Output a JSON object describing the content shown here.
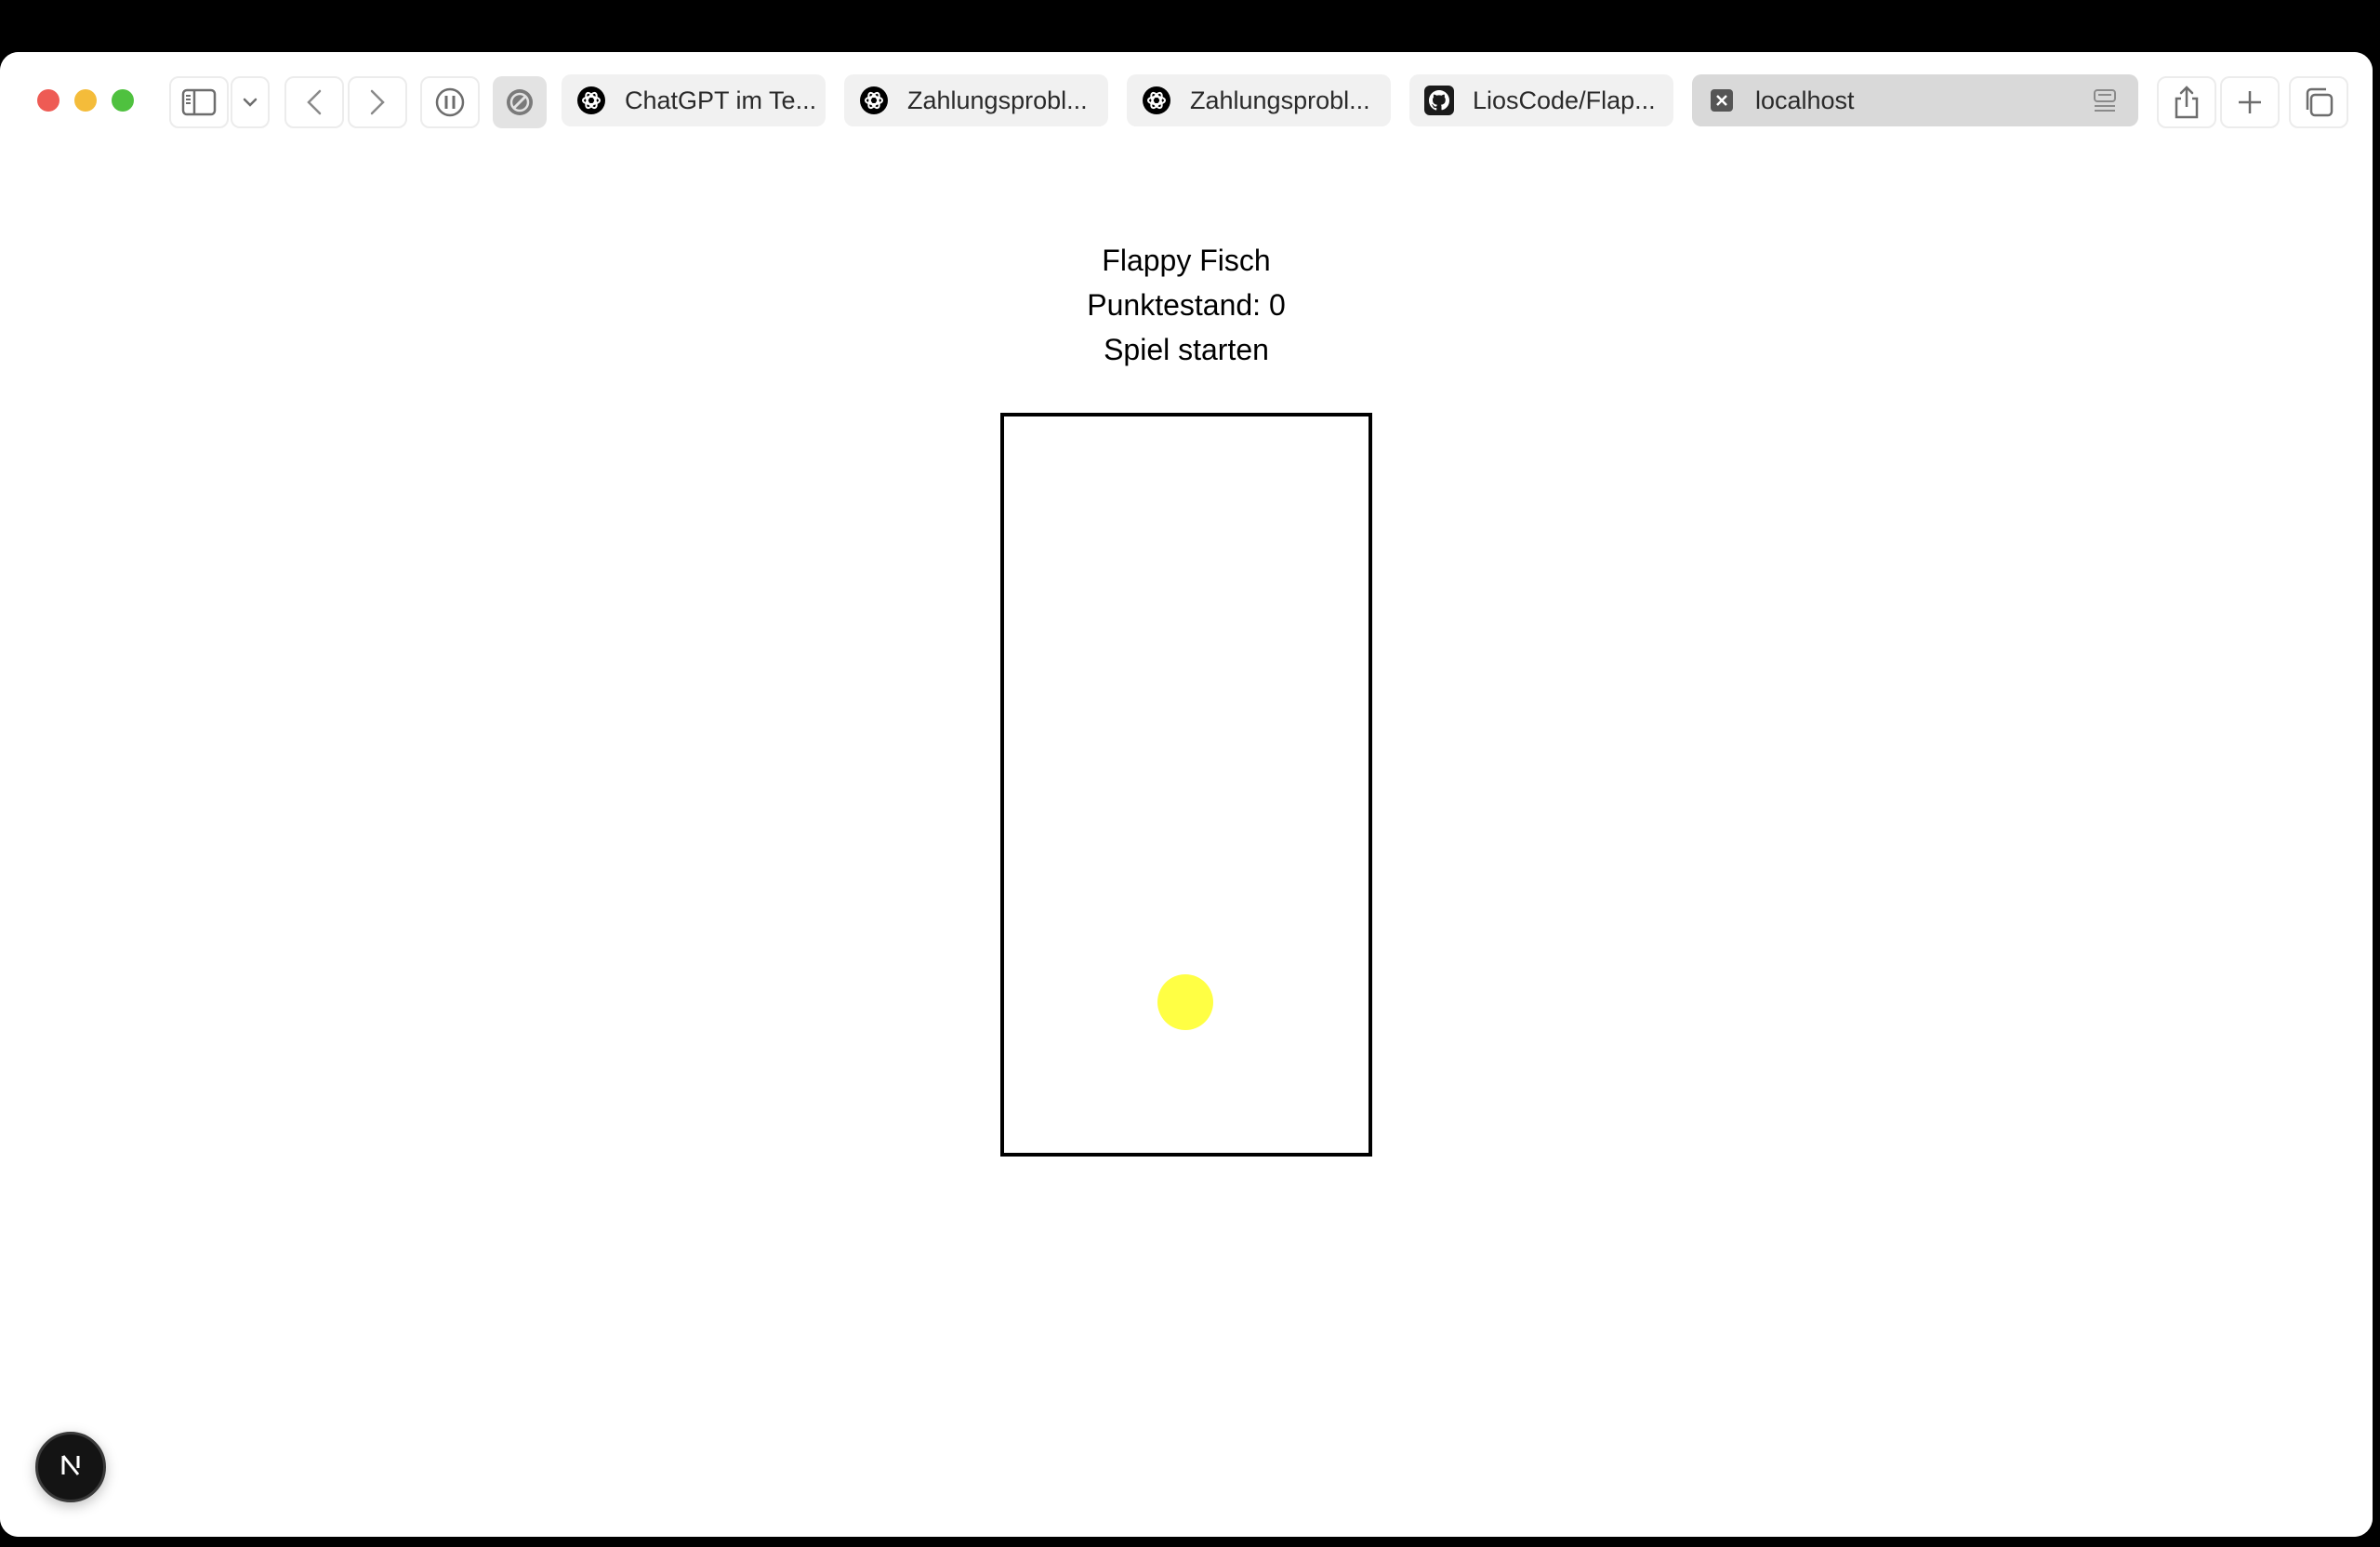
{
  "browser": {
    "tabs": [
      {
        "label": "ChatGPT im Te...",
        "icon": "openai-icon",
        "active": false
      },
      {
        "label": "Zahlungsprobl...",
        "icon": "openai-icon",
        "active": false
      },
      {
        "label": "Zahlungsprobl...",
        "icon": "openai-icon",
        "active": false
      },
      {
        "label": "LiosCode/Flap...",
        "icon": "github-icon",
        "active": false
      },
      {
        "label": "localhost",
        "icon": "close-x-icon",
        "active": true
      }
    ],
    "toolbar_icons": [
      "sidebar-icon",
      "chevron-down-icon",
      "back-icon",
      "forward-icon",
      "pause-icon",
      "block-icon",
      "share-icon",
      "plus-icon",
      "tab-overview-icon"
    ]
  },
  "game": {
    "title": "Flappy Fisch",
    "score_text": "Punktestand: 0",
    "start_label": "Spiel starten",
    "fish_color": "#ffff44",
    "border_color": "#000000"
  },
  "devtools": {
    "badge_letter": "N",
    "badge_color": "#141414"
  },
  "colors": {
    "close": "#ee5b54",
    "minimize": "#f4bc3a",
    "maximize": "#4fc13f",
    "active_tab": "#d9d9d9",
    "inactive_tab": "#f1f1f1"
  }
}
